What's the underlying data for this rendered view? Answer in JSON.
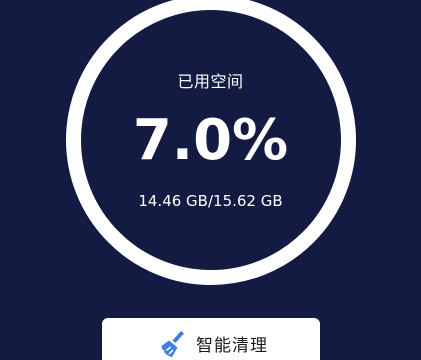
{
  "storage": {
    "label": "已用空间",
    "percent_text": "7.0%",
    "used_of_total": "14.46 GB/15.62 GB",
    "percent_value": 7.0
  },
  "actions": {
    "smart_clean_label": "智能清理",
    "smart_clean_icon": "broom-icon"
  },
  "colors": {
    "background": "#131b42",
    "ring": "#ffffff",
    "icon_accent": "#3f7fe0"
  }
}
